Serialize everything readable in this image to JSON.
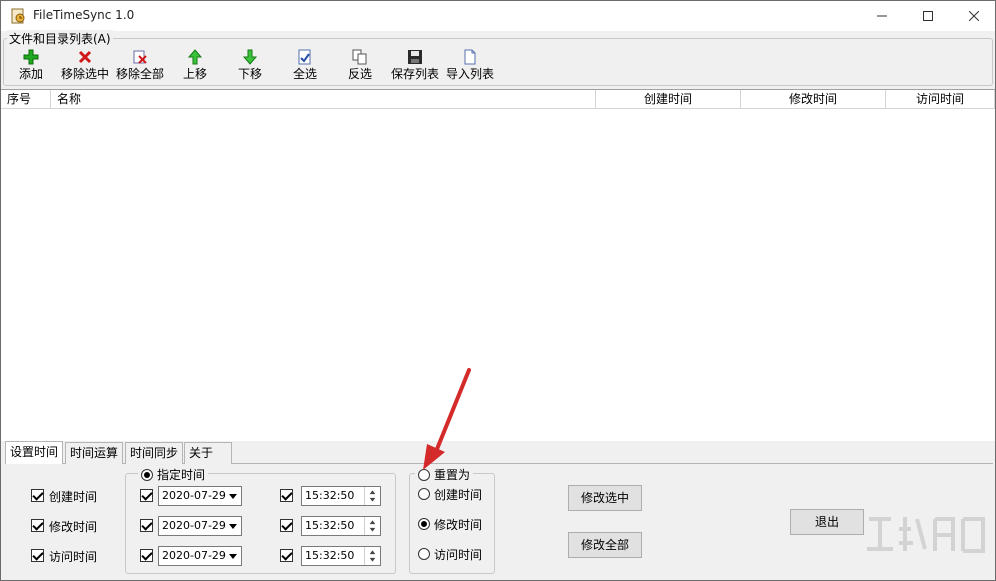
{
  "window": {
    "title": "FileTimeSync 1.0"
  },
  "toolbar": {
    "group_label": "文件和目录列表(A)",
    "buttons": [
      {
        "label": "添加",
        "icon": "add-icon"
      },
      {
        "label": "移除选中",
        "icon": "remove-selected-icon"
      },
      {
        "label": "移除全部",
        "icon": "remove-all-icon"
      },
      {
        "label": "上移",
        "icon": "arrow-up-icon"
      },
      {
        "label": "下移",
        "icon": "arrow-down-icon"
      },
      {
        "label": "全选",
        "icon": "select-all-icon"
      },
      {
        "label": "反选",
        "icon": "invert-selection-icon"
      },
      {
        "label": "保存列表",
        "icon": "save-icon"
      },
      {
        "label": "导入列表",
        "icon": "import-icon"
      }
    ]
  },
  "list": {
    "columns": [
      "序号",
      "名称",
      "创建时间",
      "修改时间",
      "访问时间"
    ],
    "rows": []
  },
  "tabs": [
    {
      "label": "设置时间",
      "active": true
    },
    {
      "label": "时间运算",
      "active": false
    },
    {
      "label": "时间同步",
      "active": false
    },
    {
      "label": "关于",
      "active": false
    }
  ],
  "set_time": {
    "targets": [
      {
        "label": "创建时间",
        "checked": true
      },
      {
        "label": "修改时间",
        "checked": true
      },
      {
        "label": "访问时间",
        "checked": true
      }
    ],
    "specified_group": {
      "label": "指定时间",
      "selected": true,
      "rows": [
        {
          "date": "2020-07-29",
          "time": "15:32:50",
          "date_checked": true,
          "time_checked": true
        },
        {
          "date": "2020-07-29",
          "time": "15:32:50",
          "date_checked": true,
          "time_checked": true
        },
        {
          "date": "2020-07-29",
          "time": "15:32:50",
          "date_checked": true,
          "time_checked": true
        }
      ]
    },
    "reset_group": {
      "label": "重置为",
      "selected": false,
      "options": [
        {
          "label": "创建时间",
          "selected": false
        },
        {
          "label": "修改时间",
          "selected": true
        },
        {
          "label": "访问时间",
          "selected": false
        }
      ]
    },
    "buttons": {
      "modify_selected": "修改选中",
      "modify_all": "修改全部",
      "exit": "退出"
    }
  },
  "colors": {
    "annotation_arrow": "#d42a2a",
    "watermark": "#cfcfcf"
  }
}
